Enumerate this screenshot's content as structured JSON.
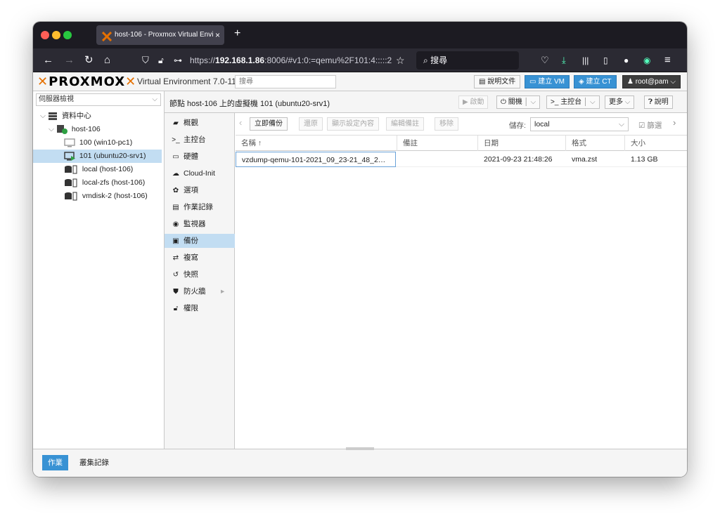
{
  "browser": {
    "tab_title": "host-106 - Proxmox Virtual Envi",
    "tab_close": "×",
    "new_tab": "+",
    "url_scheme": "https://",
    "url_host": "192.168.1.86",
    "url_rest": ":8006/#v1:0:=qemu%2F101:4:::::2",
    "search_label": "搜尋"
  },
  "header": {
    "logo_text": "PROXMOX",
    "version": "Virtual Environment 7.0-11",
    "search_placeholder": "搜尋",
    "docs": "說明文件",
    "create_vm": "建立 VM",
    "create_ct": "建立 CT",
    "user": "root@pam"
  },
  "left": {
    "view_selector": "伺服器檢視",
    "tree": [
      {
        "label": "資料中心",
        "icon": "datacenter-icon"
      },
      {
        "label": "host-106",
        "icon": "node-online-icon"
      },
      {
        "label": "100 (win10-pc1)",
        "icon": "vm-stopped-icon"
      },
      {
        "label": "101 (ubuntu20-srv1)",
        "icon": "vm-running-icon"
      },
      {
        "label": "local (host-106)",
        "icon": "storage-icon"
      },
      {
        "label": "local-zfs (host-106)",
        "icon": "storage-icon"
      },
      {
        "label": "vmdisk-2 (host-106)",
        "icon": "storage-icon"
      }
    ]
  },
  "content": {
    "title": "節點 host-106 上的虛擬機 101 (ubuntu20-srv1)",
    "start": "啟動",
    "shutdown": "關機",
    "console": "主控台",
    "more": "更多",
    "help": "說明"
  },
  "menu": [
    {
      "label": "概觀",
      "icon": "book-icon"
    },
    {
      "label": "主控台",
      "icon": "terminal-icon"
    },
    {
      "label": "硬體",
      "icon": "monitor-icon"
    },
    {
      "label": "Cloud-Init",
      "icon": "cloud-icon"
    },
    {
      "label": "選項",
      "icon": "gear-icon"
    },
    {
      "label": "作業記錄",
      "icon": "list-icon"
    },
    {
      "label": "監視器",
      "icon": "eye-icon"
    },
    {
      "label": "備份",
      "icon": "floppy-icon"
    },
    {
      "label": "複寫",
      "icon": "retweet-icon"
    },
    {
      "label": "快照",
      "icon": "history-icon"
    },
    {
      "label": "防火牆",
      "icon": "shield-icon"
    },
    {
      "label": "權限",
      "icon": "unlock-icon"
    }
  ],
  "backup": {
    "backup_now": "立即備份",
    "restore": "還原",
    "show_config": "顯示設定內容",
    "edit_notes": "編輯備註",
    "remove": "移除",
    "storage_label": "儲存:",
    "storage_value": "local",
    "filter_label": "篩選",
    "columns": [
      "名稱 ↑",
      "備註",
      "日期",
      "格式",
      "大小"
    ],
    "rows": [
      [
        "vzdump-qemu-101-2021_09_23-21_48_2…",
        "",
        "2021-09-23 21:48:26",
        "vma.zst",
        "1.13 GB"
      ]
    ]
  },
  "bottom": {
    "tasks": "作業",
    "cluster_log": "叢集記錄"
  }
}
